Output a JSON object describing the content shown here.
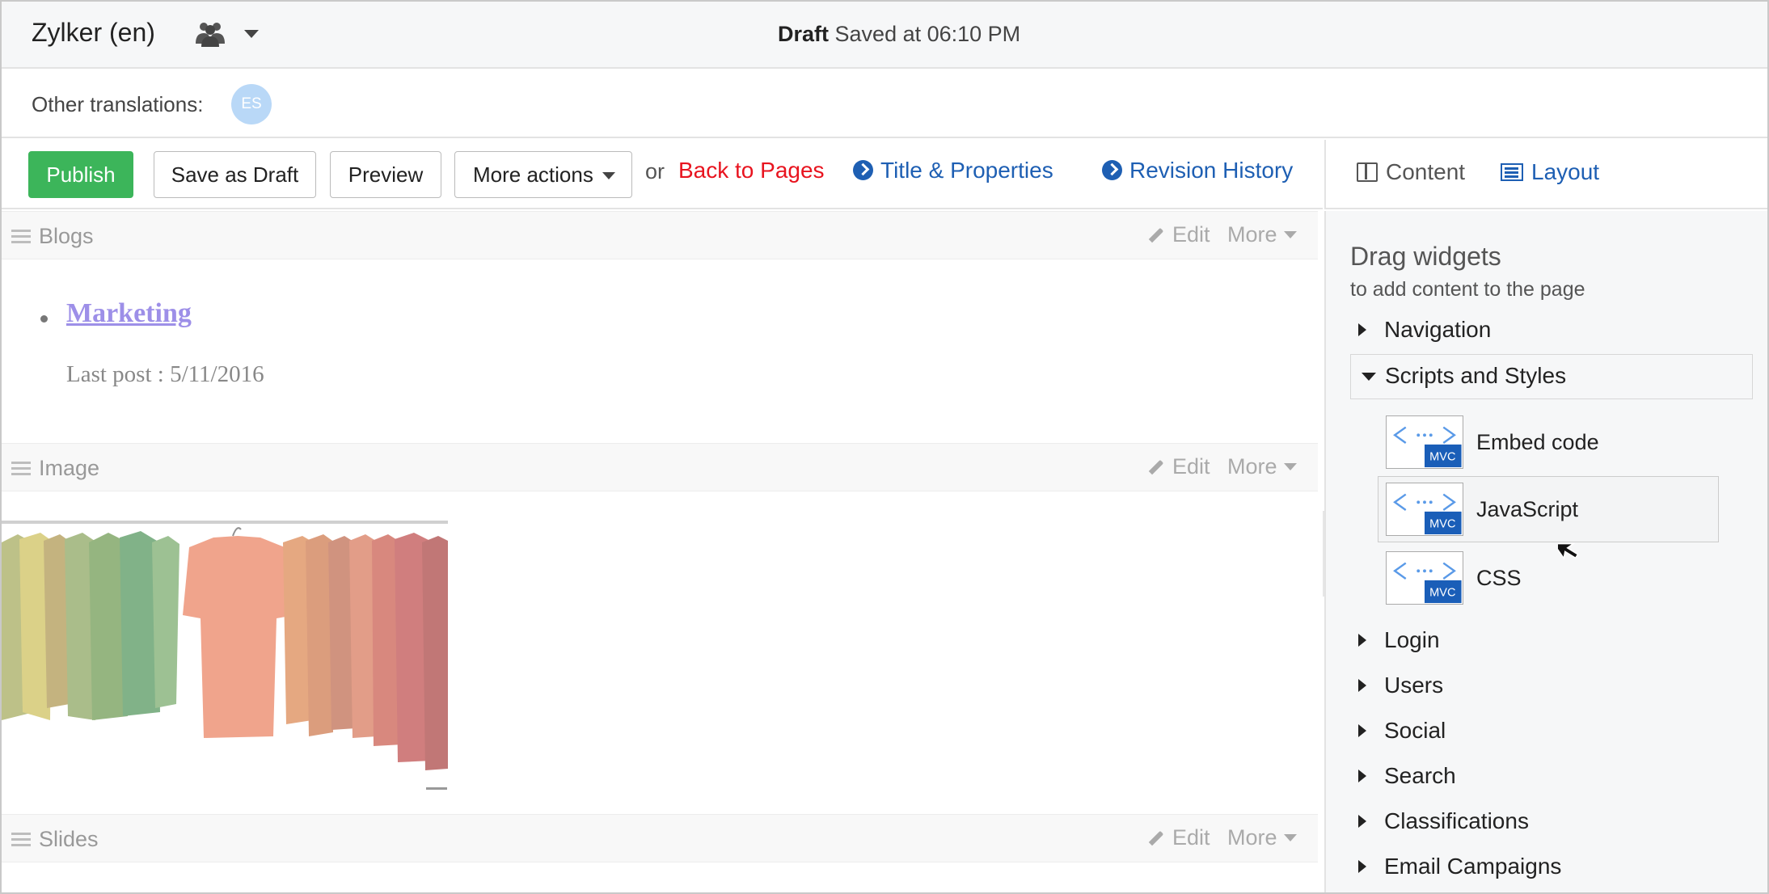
{
  "header": {
    "site_name": "Zylker (en)",
    "status_strong": "Draft",
    "status_text": "Saved at 06:10 PM"
  },
  "translations": {
    "label": "Other translations:",
    "languages": [
      "ES"
    ]
  },
  "toolbar": {
    "publish": "Publish",
    "save_draft": "Save as Draft",
    "preview": "Preview",
    "more_actions": "More actions",
    "or": "or",
    "back": "Back to Pages",
    "title_props": "Title & Properties",
    "revision": "Revision History"
  },
  "panel_tabs": {
    "content": "Content",
    "layout": "Layout",
    "active": "Layout"
  },
  "canvas": {
    "sections": [
      {
        "title": "Blogs",
        "edit": "Edit",
        "more": "More"
      },
      {
        "title": "Image",
        "edit": "Edit",
        "more": "More"
      },
      {
        "title": "Slides",
        "edit": "Edit",
        "more": "More"
      }
    ],
    "blog": {
      "title": "Marketing",
      "last_post": "Last post : 5/11/2016"
    }
  },
  "widgets": {
    "title": "Drag widgets",
    "subtitle": "to add content to the page",
    "categories_before": [
      "Navigation"
    ],
    "open_category": "Scripts and Styles",
    "items": [
      {
        "label": "Embed code",
        "icon_tag": "MVC"
      },
      {
        "label": "JavaScript",
        "icon_tag": "MVC"
      },
      {
        "label": "CSS",
        "icon_tag": "MVC"
      }
    ],
    "categories_after": [
      "Login",
      "Users",
      "Social",
      "Search",
      "Classifications",
      "Email Campaigns"
    ]
  },
  "colors": {
    "publish": "#3cb55a",
    "back_link": "#e8141f",
    "link": "#1e5fb3",
    "blog_title": "#9d8fe8",
    "mvc_badge": "#1a5eb8"
  },
  "icons": [
    "group-icon",
    "caret-down-icon",
    "circle-arrow-icon",
    "columns-icon",
    "layout-list-icon",
    "drag-handle-icon",
    "pencil-icon",
    "embed-code-icon",
    "mouse-cursor-icon"
  ]
}
